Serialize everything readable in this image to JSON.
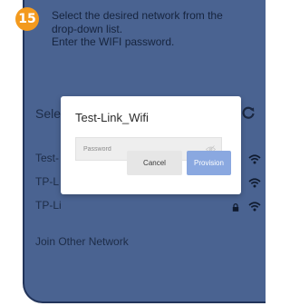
{
  "step_badge": "15",
  "instructions": [
    "Select the desired network from the",
    "drop-down list.",
    "Enter the WIFI password."
  ],
  "network_screen": {
    "heading": "Sele",
    "networks": [
      {
        "label": "Test-"
      },
      {
        "label": "TP-L"
      },
      {
        "label": "TP-Li"
      }
    ],
    "join_label": "Join Other Network"
  },
  "dialog": {
    "title": "Test-Link_Wifi",
    "password_placeholder": "Password",
    "cancel_label": "Cancel",
    "provision_label": "Provision"
  },
  "colors": {
    "badge": "#f39a1e",
    "frame": "#4a6391",
    "provision_button": "#8aa8e0",
    "cancel_button": "#e6e6e6"
  }
}
